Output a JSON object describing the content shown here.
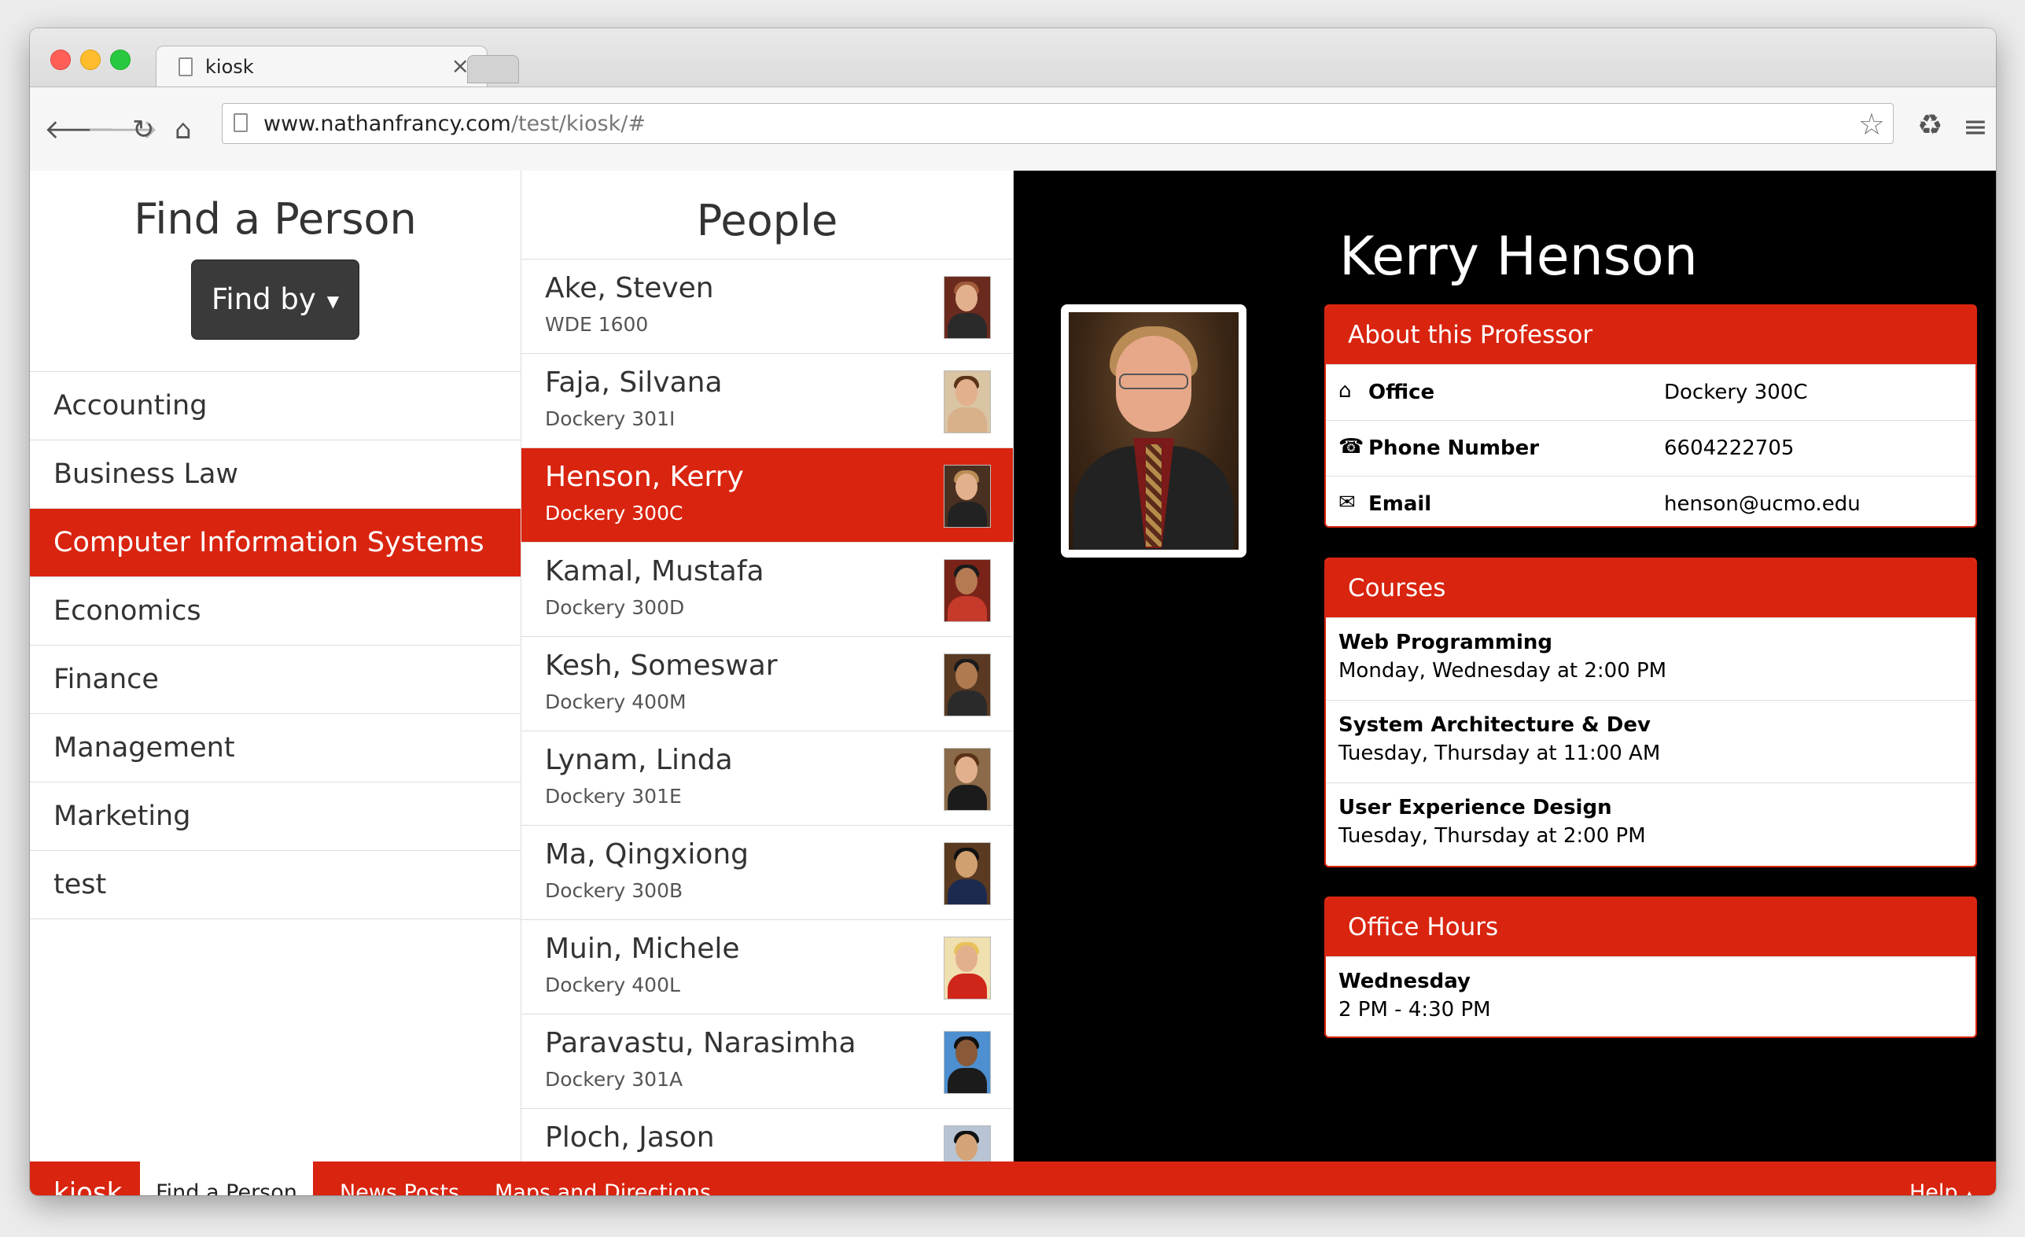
{
  "browser": {
    "tab_title": "kiosk",
    "tab_close": "×",
    "url_host": "www.nathanfrancy.com",
    "url_path": "/test/kiosk/#"
  },
  "left": {
    "title": "Find a Person",
    "findby_label": "Find by",
    "departments": [
      {
        "label": "Accounting",
        "active": false
      },
      {
        "label": "Business Law",
        "active": false
      },
      {
        "label": "Computer Information Systems",
        "active": true
      },
      {
        "label": "Economics",
        "active": false
      },
      {
        "label": "Finance",
        "active": false
      },
      {
        "label": "Management",
        "active": false
      },
      {
        "label": "Marketing",
        "active": false
      },
      {
        "label": "test",
        "active": false
      }
    ]
  },
  "middle": {
    "title": "People",
    "people": [
      {
        "name": "Ake, Steven",
        "office": "WDE 1600",
        "active": false
      },
      {
        "name": "Faja, Silvana",
        "office": "Dockery 301I",
        "active": false
      },
      {
        "name": "Henson, Kerry",
        "office": "Dockery 300C",
        "active": true
      },
      {
        "name": "Kamal, Mustafa",
        "office": "Dockery 300D",
        "active": false
      },
      {
        "name": "Kesh, Someswar",
        "office": "Dockery 400M",
        "active": false
      },
      {
        "name": "Lynam, Linda",
        "office": "Dockery 301E",
        "active": false
      },
      {
        "name": "Ma, Qingxiong",
        "office": "Dockery 300B",
        "active": false
      },
      {
        "name": "Muin, Michele",
        "office": "Dockery 400L",
        "active": false
      },
      {
        "name": "Paravastu, Narasimha",
        "office": "Dockery 301A",
        "active": false
      },
      {
        "name": "Ploch, Jason",
        "office": "",
        "active": false
      }
    ]
  },
  "detail": {
    "name": "Kerry Henson",
    "about": {
      "title": "About this Professor",
      "office_label": "Office",
      "office_value": "Dockery 300C",
      "phone_label": "Phone Number",
      "phone_value": "6604222705",
      "email_label": "Email",
      "email_value": "henson@ucmo.edu"
    },
    "courses": {
      "title": "Courses",
      "items": [
        {
          "name": "Web Programming",
          "schedule": "Monday, Wednesday at 2:00 PM"
        },
        {
          "name": "System Architecture & Dev",
          "schedule": "Tuesday, Thursday at 11:00 AM"
        },
        {
          "name": "User Experience Design",
          "schedule": "Tuesday, Thursday at 2:00 PM"
        }
      ]
    },
    "office_hours": {
      "title": "Office Hours",
      "day": "Wednesday",
      "time": "2 PM - 4:30 PM"
    }
  },
  "bottom_nav": {
    "brand": "kiosk",
    "find_person": "Find a Person",
    "news": "News Posts",
    "maps": "Maps and Directions",
    "help": "Help"
  },
  "colors": {
    "accent": "#d9240f",
    "dark": "#000000"
  }
}
